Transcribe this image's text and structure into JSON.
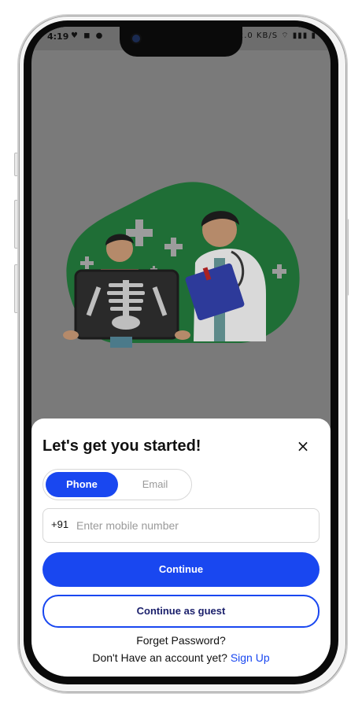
{
  "status_bar": {
    "time": "4:19",
    "left_icons": "♥ ◼ ●",
    "right_icons": "✱ 12.0 KB/S ⌔ ▮▮▮ ▮"
  },
  "sheet": {
    "title": "Let's get you started!",
    "close_icon": "×",
    "tabs": {
      "phone": "Phone",
      "email": "Email",
      "active": "phone"
    },
    "phone_field": {
      "country_code": "+91",
      "placeholder": "Enter mobile number",
      "value": ""
    },
    "continue_label": "Continue",
    "guest_label": "Continue as guest",
    "forgot_label": "Forget Password?",
    "signup_prompt": "Don't Have an account yet?",
    "signup_link": "Sign Up"
  },
  "colors": {
    "accent": "#1947f0",
    "overlay": "#7a7a7a",
    "blob": "#1f6e36"
  }
}
